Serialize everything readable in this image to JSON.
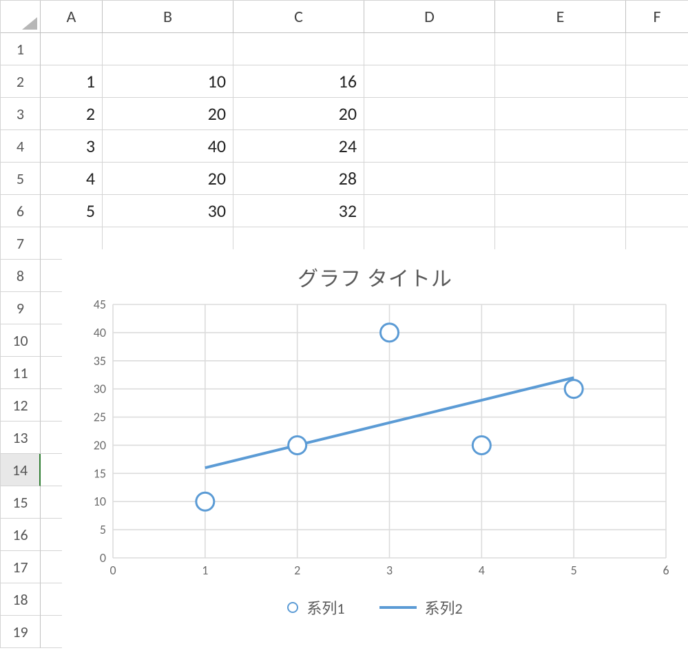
{
  "spreadsheet": {
    "columns": [
      "A",
      "B",
      "C",
      "D",
      "E",
      "F"
    ],
    "row_headers": [
      "1",
      "2",
      "3",
      "4",
      "5",
      "6",
      "7",
      "8",
      "9",
      "10",
      "11",
      "12",
      "13",
      "14",
      "15",
      "16",
      "17",
      "18",
      "19"
    ],
    "selected_row": 14,
    "cells": {
      "A2": "1",
      "B2": "10",
      "C2": "16",
      "A3": "2",
      "B3": "20",
      "C3": "20",
      "A4": "3",
      "B4": "40",
      "C4": "24",
      "A5": "4",
      "B5": "20",
      "C5": "28",
      "A6": "5",
      "B6": "30",
      "C6": "32"
    }
  },
  "chart_data": {
    "type": "scatter",
    "title": "グラフ タイトル",
    "x": [
      1,
      2,
      3,
      4,
      5
    ],
    "series": [
      {
        "name": "系列1",
        "values": [
          10,
          20,
          40,
          20,
          30
        ],
        "render": "markers"
      },
      {
        "name": "系列2",
        "values": [
          16,
          20,
          24,
          28,
          32
        ],
        "render": "line"
      }
    ],
    "x_ticks": [
      0,
      1,
      2,
      3,
      4,
      5,
      6
    ],
    "y_ticks": [
      0,
      5,
      10,
      15,
      20,
      25,
      30,
      35,
      40,
      45
    ],
    "xlim": [
      0,
      6
    ],
    "ylim": [
      0,
      45
    ],
    "legend_position": "bottom",
    "colors": {
      "series": "#5b9bd5",
      "grid": "#dcdcdc"
    }
  }
}
